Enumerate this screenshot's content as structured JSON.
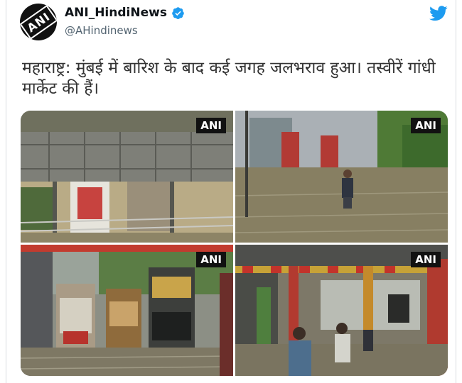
{
  "account": {
    "display_name": "ANI_HindiNews",
    "handle": "@AHindinews",
    "avatar_text": "ANI"
  },
  "tweet": {
    "text": "महाराष्ट्र: मुंबई में बारिश के बाद कई जगह जलभराव हुआ। तस्वीरें गांधी मार्केट की हैं।"
  },
  "photos": [
    {
      "watermark": "ANI"
    },
    {
      "watermark": "ANI"
    },
    {
      "watermark": "ANI"
    },
    {
      "watermark": "ANI"
    }
  ],
  "colors": {
    "verified_blue": "#1d9bf0",
    "twitter_blue": "#1d9bf0",
    "flood_water": "#8a8468"
  },
  "icons": [
    "verified-badge-icon",
    "twitter-bird-icon"
  ]
}
